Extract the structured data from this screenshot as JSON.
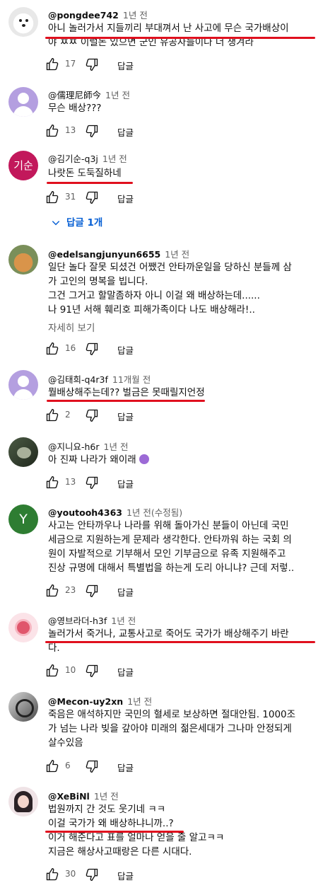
{
  "comments": [
    {
      "author": "@pongdee742",
      "time": "1년 전",
      "lines": [
        "아니 놀러가서 지들끼리 부대껴서 난 사고에 무슨 국가배상이",
        "야 ㅉㅉ 이럴돈 있으면 군인 유공자들이나 더 챙겨라"
      ],
      "likes": "17",
      "reply": "답글",
      "avatar": "dog-photo"
    },
    {
      "author": "@儒理尼師今",
      "time": "1년 전",
      "lines": [
        "무슨 배상???"
      ],
      "likes": "13",
      "reply": "답글",
      "avatar": "default-person"
    },
    {
      "author": "@김기순-q3j",
      "time": "1년 전",
      "lines": [
        "나랏돈 도둑질하네"
      ],
      "likes": "31",
      "reply": "답글",
      "avatar_text": "기순",
      "replies_label": "답글 1개"
    },
    {
      "author": "@edelsangjunyun6655",
      "time": "1년 전",
      "lines": [
        "일단 놀다 잘못 되셨건 어쨌건 안타까운일을 당하신 분들께 삼",
        "가 고인의 명복을 빕니다.",
        "그건 그거고 할말좀하자 아니 이걸 왜 배상하는데......",
        "나 91년 서해 훼리호 피해가족이다 나도 배상해라!.."
      ],
      "more": "자세히 보기",
      "likes": "16",
      "reply": "답글",
      "avatar": "cat-photo"
    },
    {
      "author": "@김태희-q4r3f",
      "time": "11개월 전",
      "lines": [
        "뭘배상해주는데??  벌금은 못때릴지언정"
      ],
      "likes": "2",
      "reply": "답글",
      "avatar": "default-person"
    },
    {
      "author": "@지니요-h6r",
      "time": "1년 전",
      "lines": [
        "아 진짜 나라가 왜이래"
      ],
      "likes": "13",
      "reply": "답글",
      "avatar": "dark-photo"
    },
    {
      "author": "@youtooh4363",
      "time": "1년 전(수정됨)",
      "lines": [
        "사고는 안타까우나 나라를 위해 돌아가신 분들이 아닌데 국민",
        "세금으로 지원하는게 문제라 생각한다. 안타까워 하는 국회 의",
        "원이 자발적으로 기부해서 모인 기부금으로 유족 지원해주고",
        "진상 규명에 대해서 특별법을 하는게 도리 아니냐? 근데 저렇.."
      ],
      "likes": "23",
      "reply": "답글",
      "avatar_text": "Y"
    },
    {
      "author": "@영브라더-h3f",
      "time": "1년 전",
      "lines": [
        "놀러가서 죽거나, 교통사고로 죽어도 국가가 배상해주기 바란",
        "다."
      ],
      "likes": "10",
      "reply": "답글",
      "avatar": "flower"
    },
    {
      "author": "@Mecon-uy2xn",
      "time": "1년 전",
      "lines": [
        "죽음은 애석하지만 국민의 혈세로 보상하면 절대안됨. 1000조",
        "가 넘는 나라 빚을 갚아야 미래의 젊은세대가 그나마 안정되게",
        "살수있음"
      ],
      "likes": "6",
      "reply": "답글",
      "avatar": "gray-photo"
    },
    {
      "author": "@XeBiNl",
      "time": "1년 전",
      "lines": [
        "법원까지 간 것도 웃기네 ㅋㅋ",
        "이걸 국가가 왜 배상하냐니까..?",
        "이거 해준다고 표를 얼마나 얻을 줄 알고ㅋㅋ",
        "지금은 해상사고때랑은 다른 시대다."
      ],
      "likes": "30",
      "reply": "답글",
      "avatar": "girl-photo"
    }
  ],
  "colors": {
    "underline": "#e0101e",
    "link": "#065fd4",
    "meta": "#606060"
  }
}
